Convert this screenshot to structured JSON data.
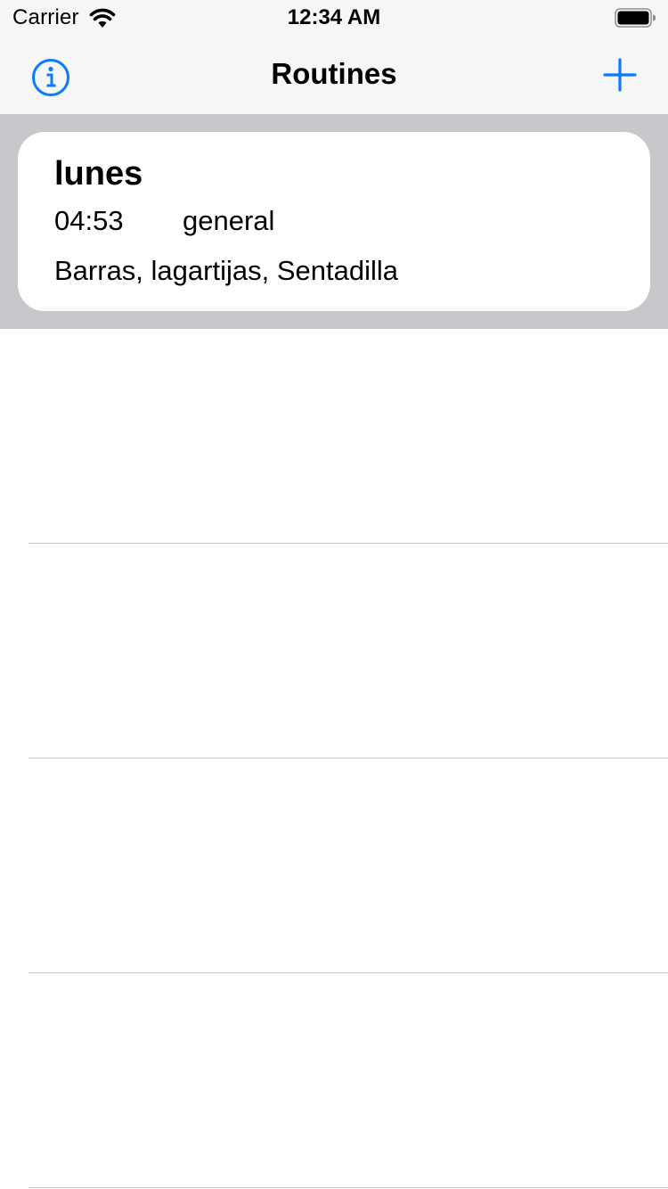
{
  "status_bar": {
    "carrier": "Carrier",
    "time": "12:34 AM"
  },
  "nav": {
    "title": "Routines",
    "left_icon": "info-icon",
    "right_icon": "plus-icon",
    "accent_color": "#0a7aff"
  },
  "routines": [
    {
      "title": "lunes",
      "time": "04:53",
      "category": "general",
      "exercises": "Barras, lagartijas, Sentadilla"
    }
  ],
  "colors": {
    "selected_row": "#c7c7cc",
    "bar_background": "#f6f6f6",
    "separator": "#c8c7cc"
  }
}
